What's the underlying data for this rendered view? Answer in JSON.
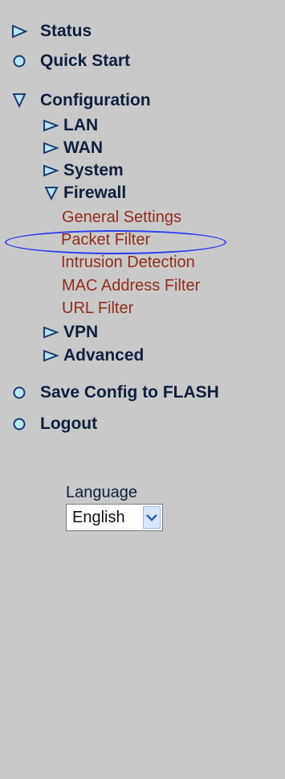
{
  "menu": {
    "top_items": [
      {
        "label": "Status",
        "icon": "triangle-right-icon"
      },
      {
        "label": "Quick Start",
        "icon": "circle-icon"
      },
      {
        "label": "Configuration",
        "icon": "triangle-down-icon"
      },
      {
        "label": "Save Config to FLASH",
        "icon": "circle-icon"
      },
      {
        "label": "Logout",
        "icon": "circle-icon"
      }
    ],
    "config_children": [
      {
        "label": "LAN",
        "icon": "triangle-right-icon"
      },
      {
        "label": "WAN",
        "icon": "triangle-right-icon"
      },
      {
        "label": "System",
        "icon": "triangle-right-icon"
      },
      {
        "label": "Firewall",
        "icon": "triangle-down-icon"
      },
      {
        "label": "VPN",
        "icon": "triangle-right-icon"
      },
      {
        "label": "Advanced",
        "icon": "triangle-right-icon"
      }
    ],
    "firewall_children": [
      {
        "label": "General Settings"
      },
      {
        "label": "Packet Filter"
      },
      {
        "label": "Intrusion Detection"
      },
      {
        "label": "MAC Address Filter"
      },
      {
        "label": "URL Filter"
      }
    ]
  },
  "language": {
    "label": "Language",
    "selected": "English",
    "icon": "chevron-down-icon"
  },
  "colors": {
    "background": "#c9c9c9",
    "menu_text": "#0f1f3d",
    "leaf_text": "#8f2e1d",
    "icon_fill": "#1e3a6e",
    "highlight_ring": "#2d3de8",
    "select_arrow_bg": "#d8e6fb"
  }
}
